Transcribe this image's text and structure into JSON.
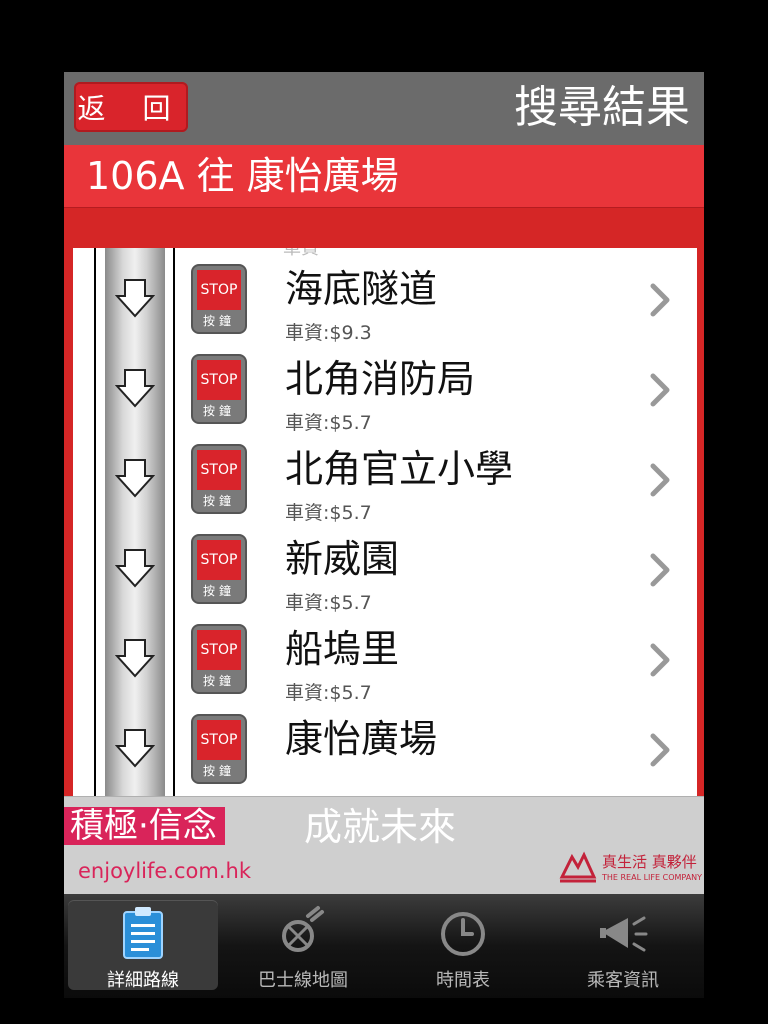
{
  "navbar": {
    "back_label": "返 回",
    "title": "搜尋結果"
  },
  "route": {
    "title": "106A 往 康怡廣場"
  },
  "list": {
    "peek_text": "車資",
    "stop_button": {
      "label": "STOP",
      "sub": "按鐘"
    },
    "stops": [
      {
        "name": "海底隧道",
        "fare": "車資:$9.3"
      },
      {
        "name": "北角消防局",
        "fare": "車資:$5.7"
      },
      {
        "name": "北角官立小學",
        "fare": "車資:$5.7"
      },
      {
        "name": "新威園",
        "fare": "車資:$5.7"
      },
      {
        "name": "船塢里",
        "fare": "車資:$5.7"
      },
      {
        "name": "康怡廣場",
        "fare": ""
      }
    ]
  },
  "ad": {
    "tagline": "積極·信念",
    "slogan": "成就未來",
    "url": "enjoylife.com.hk",
    "logo_text": "真生活 真夥伴",
    "logo_sub": "THE REAL LIFE COMPANY"
  },
  "tabs": [
    {
      "label": "詳細路線",
      "icon": "clipboard-icon",
      "active": true
    },
    {
      "label": "巴士線地圖",
      "icon": "bus-map-icon",
      "active": false
    },
    {
      "label": "時間表",
      "icon": "clock-icon",
      "active": false
    },
    {
      "label": "乘客資訊",
      "icon": "megaphone-icon",
      "active": false
    }
  ],
  "colors": {
    "accent": "#d9242b",
    "navbar": "#6b6b6b",
    "ad_pink": "#d9245a"
  }
}
